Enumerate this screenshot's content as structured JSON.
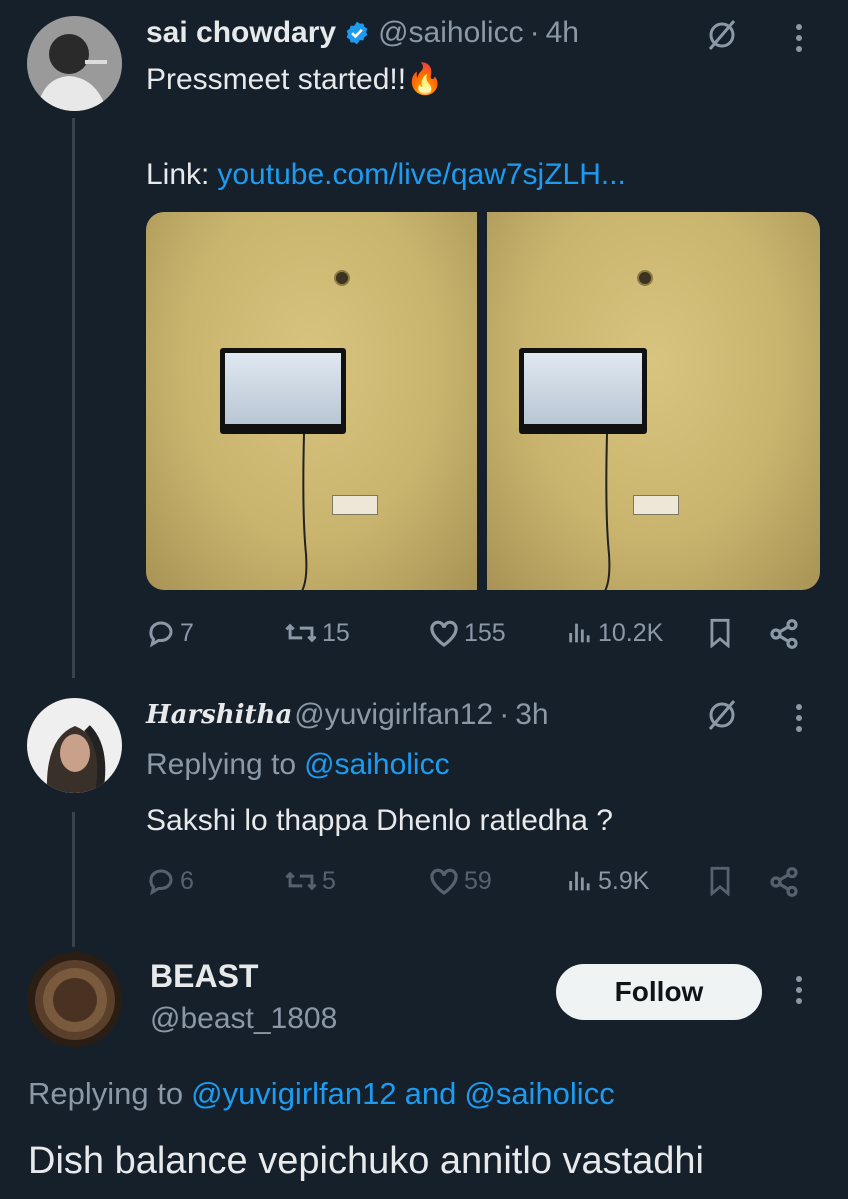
{
  "tweet1": {
    "name": "sai chowdary",
    "handle": "@saiholicc",
    "sep": "·",
    "time": "4h",
    "text": "Pressmeet started!!🔥",
    "link_label": "Link:",
    "link_url": "youtube.com/live/qaw7sjZLH...",
    "stats": {
      "replies": "7",
      "retweets": "15",
      "likes": "155",
      "views": "10.2K"
    }
  },
  "tweet2": {
    "name": "𝑯𝒂𝒓𝒔𝒉𝒊𝒕𝒉𝒂",
    "handle": "@yuvigirlfan12",
    "sep": "·",
    "time": "3h",
    "replying_prefix": "Replying to",
    "replying_to": "@saiholicc",
    "text": "Sakshi lo thappa Dhenlo ratledha ?",
    "stats": {
      "replies": "6",
      "retweets": "5",
      "likes": "59",
      "views": "5.9K"
    }
  },
  "tweet3": {
    "name": "BEAST",
    "handle": "@beast_1808",
    "follow_label": "Follow",
    "replying_prefix": "Replying to",
    "replying_to_1": "@yuvigirlfan12",
    "replying_and": "and",
    "replying_to_2": "@saiholicc",
    "text": "Dish balance vepichuko annitlo vastadhi"
  },
  "colors": {
    "background": "#15202b",
    "accent": "#1d9bf0",
    "muted": "#8b98a5",
    "text": "#e7e9ea"
  },
  "icons": [
    "verified-badge-icon",
    "grok-icon",
    "more-icon",
    "reply-icon",
    "retweet-icon",
    "like-icon",
    "views-icon",
    "bookmark-icon",
    "share-icon"
  ]
}
